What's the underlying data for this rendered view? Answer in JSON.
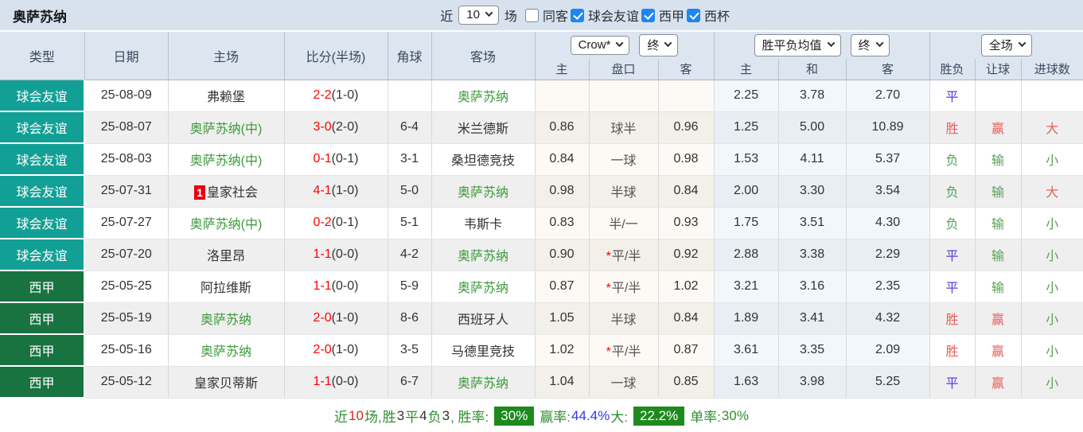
{
  "topbar": {
    "team": "奥萨苏纳",
    "near_label": "近",
    "near_value": "10",
    "games_label": "场",
    "filters": [
      {
        "label": "同客",
        "checked": false
      },
      {
        "label": "球会友谊",
        "checked": true
      },
      {
        "label": "西甲",
        "checked": true
      },
      {
        "label": "西杯",
        "checked": true
      }
    ]
  },
  "table": {
    "headers": {
      "type": "类型",
      "date": "日期",
      "home": "主场",
      "score": "比分(半场)",
      "corner": "角球",
      "away": "客场",
      "crow_select": "Crow*",
      "crow_final_select": "终",
      "avg_select": "胜平负均值",
      "avg_final_select": "终",
      "fullmatch_select": "全场",
      "sub": [
        "主",
        "盘口",
        "客",
        "主",
        "和",
        "客",
        "胜负",
        "让球",
        "进球数"
      ]
    },
    "rows": [
      {
        "league": "球会友谊",
        "lg": "friendly",
        "date": "25-08-09",
        "home": "弗赖堡",
        "homeGreen": false,
        "badge": "",
        "score": "2-2",
        "half": "(1-0)",
        "corner": "",
        "away": "奥萨苏纳",
        "awayGreen": true,
        "ch": "",
        "hc": "",
        "star": false,
        "ca": "",
        "ah": "2.25",
        "ad": "3.78",
        "aa": "2.70",
        "res": "平",
        "resC": "draw",
        "hr": "",
        "hrC": "",
        "gl": "",
        "glC": ""
      },
      {
        "league": "球会友谊",
        "lg": "friendly",
        "date": "25-08-07",
        "home": "奥萨苏纳(中)",
        "homeGreen": true,
        "badge": "",
        "score": "3-0",
        "half": "(2-0)",
        "corner": "6-4",
        "away": "米兰德斯",
        "awayGreen": false,
        "ch": "0.86",
        "hc": "球半",
        "star": false,
        "ca": "0.96",
        "ah": "1.25",
        "ad": "5.00",
        "aa": "10.89",
        "res": "胜",
        "resC": "win",
        "hr": "赢",
        "hrC": "win",
        "gl": "大",
        "glC": "win"
      },
      {
        "league": "球会友谊",
        "lg": "friendly",
        "date": "25-08-03",
        "home": "奥萨苏纳(中)",
        "homeGreen": true,
        "badge": "",
        "score": "0-1",
        "half": "(0-1)",
        "corner": "3-1",
        "away": "桑坦德竞技",
        "awayGreen": false,
        "ch": "0.84",
        "hc": "一球",
        "star": false,
        "ca": "0.98",
        "ah": "1.53",
        "ad": "4.11",
        "aa": "5.37",
        "res": "负",
        "resC": "lose",
        "hr": "输",
        "hrC": "lose",
        "gl": "小",
        "glC": "lose"
      },
      {
        "league": "球会友谊",
        "lg": "friendly",
        "date": "25-07-31",
        "home": "皇家社会",
        "homeGreen": false,
        "badge": "1",
        "score": "4-1",
        "half": "(1-0)",
        "corner": "5-0",
        "away": "奥萨苏纳",
        "awayGreen": true,
        "ch": "0.98",
        "hc": "半球",
        "star": false,
        "ca": "0.84",
        "ah": "2.00",
        "ad": "3.30",
        "aa": "3.54",
        "res": "负",
        "resC": "lose",
        "hr": "输",
        "hrC": "lose",
        "gl": "大",
        "glC": "win"
      },
      {
        "league": "球会友谊",
        "lg": "friendly",
        "date": "25-07-27",
        "home": "奥萨苏纳(中)",
        "homeGreen": true,
        "badge": "",
        "score": "0-2",
        "half": "(0-1)",
        "corner": "5-1",
        "away": "韦斯卡",
        "awayGreen": false,
        "ch": "0.83",
        "hc": "半/一",
        "star": false,
        "ca": "0.93",
        "ah": "1.75",
        "ad": "3.51",
        "aa": "4.30",
        "res": "负",
        "resC": "lose",
        "hr": "输",
        "hrC": "lose",
        "gl": "小",
        "glC": "lose"
      },
      {
        "league": "球会友谊",
        "lg": "friendly",
        "date": "25-07-20",
        "home": "洛里昂",
        "homeGreen": false,
        "badge": "",
        "score": "1-1",
        "half": "(0-0)",
        "corner": "4-2",
        "away": "奥萨苏纳",
        "awayGreen": true,
        "ch": "0.90",
        "hc": "平/半",
        "star": true,
        "ca": "0.92",
        "ah": "2.88",
        "ad": "3.38",
        "aa": "2.29",
        "res": "平",
        "resC": "draw",
        "hr": "输",
        "hrC": "lose",
        "gl": "小",
        "glC": "lose"
      },
      {
        "league": "西甲",
        "lg": "liga",
        "date": "25-05-25",
        "home": "阿拉维斯",
        "homeGreen": false,
        "badge": "",
        "score": "1-1",
        "half": "(0-0)",
        "corner": "5-9",
        "away": "奥萨苏纳",
        "awayGreen": true,
        "ch": "0.87",
        "hc": "平/半",
        "star": true,
        "ca": "1.02",
        "ah": "3.21",
        "ad": "3.16",
        "aa": "2.35",
        "res": "平",
        "resC": "draw",
        "hr": "输",
        "hrC": "lose",
        "gl": "小",
        "glC": "lose"
      },
      {
        "league": "西甲",
        "lg": "liga",
        "date": "25-05-19",
        "home": "奥萨苏纳",
        "homeGreen": true,
        "badge": "",
        "score": "2-0",
        "half": "(1-0)",
        "corner": "8-6",
        "away": "西班牙人",
        "awayGreen": false,
        "ch": "1.05",
        "hc": "半球",
        "star": false,
        "ca": "0.84",
        "ah": "1.89",
        "ad": "3.41",
        "aa": "4.32",
        "res": "胜",
        "resC": "win",
        "hr": "赢",
        "hrC": "win",
        "gl": "小",
        "glC": "lose"
      },
      {
        "league": "西甲",
        "lg": "liga",
        "date": "25-05-16",
        "home": "奥萨苏纳",
        "homeGreen": true,
        "badge": "",
        "score": "2-0",
        "half": "(1-0)",
        "corner": "3-5",
        "away": "马德里竞技",
        "awayGreen": false,
        "ch": "1.02",
        "hc": "平/半",
        "star": true,
        "ca": "0.87",
        "ah": "3.61",
        "ad": "3.35",
        "aa": "2.09",
        "res": "胜",
        "resC": "win",
        "hr": "赢",
        "hrC": "win",
        "gl": "小",
        "glC": "lose"
      },
      {
        "league": "西甲",
        "lg": "liga",
        "date": "25-05-12",
        "home": "皇家贝蒂斯",
        "homeGreen": false,
        "badge": "",
        "score": "1-1",
        "half": "(0-0)",
        "corner": "6-7",
        "away": "奥萨苏纳",
        "awayGreen": true,
        "ch": "1.04",
        "hc": "一球",
        "star": false,
        "ca": "0.85",
        "ah": "1.63",
        "ad": "3.98",
        "aa": "5.25",
        "res": "平",
        "resC": "draw",
        "hr": "赢",
        "hrC": "win",
        "gl": "小",
        "glC": "lose"
      }
    ]
  },
  "footer": {
    "segments": [
      {
        "t": "近",
        "c": "green"
      },
      {
        "t": "10",
        "c": "red"
      },
      {
        "t": "场,",
        "c": "green"
      },
      {
        "t": "胜",
        "c": "green"
      },
      {
        "t": "3",
        "c": "dark"
      },
      {
        "t": "平",
        "c": "green"
      },
      {
        "t": "4",
        "c": "dark"
      },
      {
        "t": "负",
        "c": "green"
      },
      {
        "t": "3",
        "c": "dark"
      },
      {
        "t": ", 胜率:",
        "c": "green"
      },
      {
        "t": "30%",
        "c": "badge"
      },
      {
        "t": "赢率:",
        "c": "green"
      },
      {
        "t": "44.4%",
        "c": "blue"
      },
      {
        "t": " 大:",
        "c": "green"
      },
      {
        "t": "22.2%",
        "c": "badge"
      },
      {
        "t": "单率:",
        "c": "green"
      },
      {
        "t": "30%",
        "c": "green"
      }
    ]
  },
  "colors": {
    "friendly_type": "#12a096",
    "liga_type": "#187341",
    "team_highlight_green": "#3a9a3a",
    "score_red": "#ff0000",
    "result_win_red": "#e85d5d",
    "result_lose_green": "#58a058",
    "result_draw_blue": "#5a38e6",
    "rate_badge_green": "#1e8a1e",
    "win_rate_blue": "#3333e8",
    "checkbox_blue": "#1e86f0",
    "rank_badge_red": "#e60012"
  }
}
